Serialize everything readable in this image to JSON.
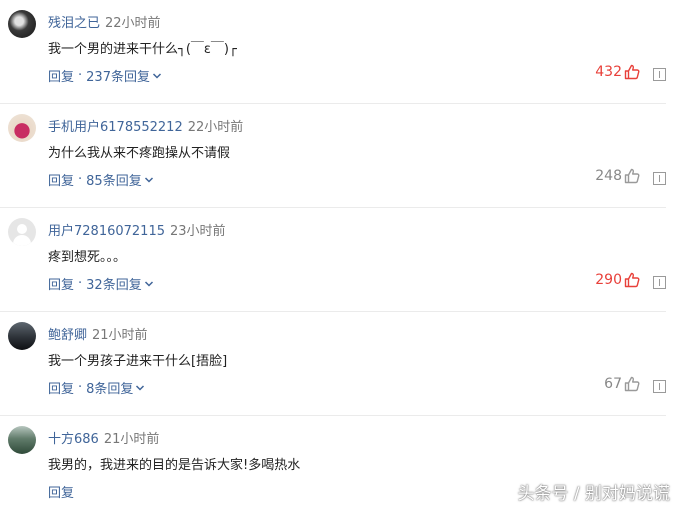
{
  "comments": [
    {
      "username": "残泪之已",
      "time": "22小时前",
      "text": "我一个男的进来干什么┐(￣ε￣)┌",
      "reply_label": "回复",
      "replies_label": "237条回复",
      "likes": "432",
      "liked": true
    },
    {
      "username": "手机用户6178552212",
      "time": "22小时前",
      "text": "为什么我从来不疼跑操从不请假",
      "reply_label": "回复",
      "replies_label": "85条回复",
      "likes": "248",
      "liked": false
    },
    {
      "username": "用户72816072115",
      "time": "23小时前",
      "text": "疼到想死。。。",
      "reply_label": "回复",
      "replies_label": "32条回复",
      "likes": "290",
      "liked": true
    },
    {
      "username": "鲍舒卿",
      "time": "21小时前",
      "text": "我一个男孩子进来干什么[捂脸]",
      "reply_label": "回复",
      "replies_label": "8条回复",
      "likes": "67",
      "liked": false
    },
    {
      "username": "十方686",
      "time": "21小时前",
      "text": "我男的，我进来的目的是告诉大家!多喝热水",
      "reply_label": "回复"
    }
  ],
  "separator": "·",
  "watermark": "头条号 / 别对妈说谎",
  "colors": {
    "link": "#406599",
    "hot": "#e8403a",
    "muted": "#888888"
  }
}
